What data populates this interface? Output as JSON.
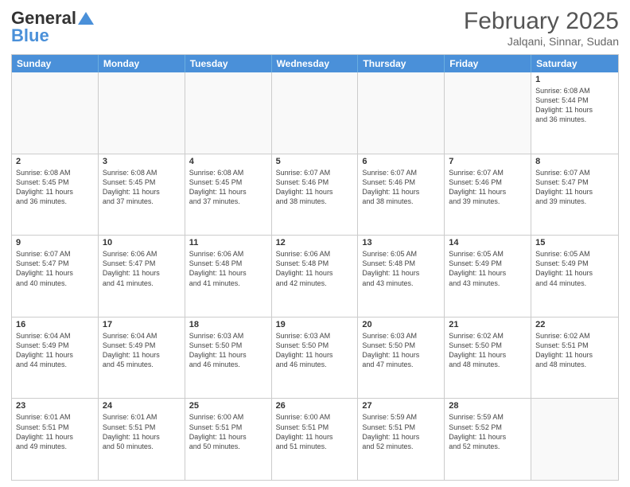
{
  "header": {
    "logo_general": "General",
    "logo_blue": "Blue",
    "month_title": "February 2025",
    "location": "Jalqani, Sinnar, Sudan"
  },
  "day_headers": [
    "Sunday",
    "Monday",
    "Tuesday",
    "Wednesday",
    "Thursday",
    "Friday",
    "Saturday"
  ],
  "weeks": [
    [
      {
        "day": "",
        "info": ""
      },
      {
        "day": "",
        "info": ""
      },
      {
        "day": "",
        "info": ""
      },
      {
        "day": "",
        "info": ""
      },
      {
        "day": "",
        "info": ""
      },
      {
        "day": "",
        "info": ""
      },
      {
        "day": "1",
        "info": "Sunrise: 6:08 AM\nSunset: 5:44 PM\nDaylight: 11 hours\nand 36 minutes."
      }
    ],
    [
      {
        "day": "2",
        "info": "Sunrise: 6:08 AM\nSunset: 5:45 PM\nDaylight: 11 hours\nand 36 minutes."
      },
      {
        "day": "3",
        "info": "Sunrise: 6:08 AM\nSunset: 5:45 PM\nDaylight: 11 hours\nand 37 minutes."
      },
      {
        "day": "4",
        "info": "Sunrise: 6:08 AM\nSunset: 5:45 PM\nDaylight: 11 hours\nand 37 minutes."
      },
      {
        "day": "5",
        "info": "Sunrise: 6:07 AM\nSunset: 5:46 PM\nDaylight: 11 hours\nand 38 minutes."
      },
      {
        "day": "6",
        "info": "Sunrise: 6:07 AM\nSunset: 5:46 PM\nDaylight: 11 hours\nand 38 minutes."
      },
      {
        "day": "7",
        "info": "Sunrise: 6:07 AM\nSunset: 5:46 PM\nDaylight: 11 hours\nand 39 minutes."
      },
      {
        "day": "8",
        "info": "Sunrise: 6:07 AM\nSunset: 5:47 PM\nDaylight: 11 hours\nand 39 minutes."
      }
    ],
    [
      {
        "day": "9",
        "info": "Sunrise: 6:07 AM\nSunset: 5:47 PM\nDaylight: 11 hours\nand 40 minutes."
      },
      {
        "day": "10",
        "info": "Sunrise: 6:06 AM\nSunset: 5:47 PM\nDaylight: 11 hours\nand 41 minutes."
      },
      {
        "day": "11",
        "info": "Sunrise: 6:06 AM\nSunset: 5:48 PM\nDaylight: 11 hours\nand 41 minutes."
      },
      {
        "day": "12",
        "info": "Sunrise: 6:06 AM\nSunset: 5:48 PM\nDaylight: 11 hours\nand 42 minutes."
      },
      {
        "day": "13",
        "info": "Sunrise: 6:05 AM\nSunset: 5:48 PM\nDaylight: 11 hours\nand 43 minutes."
      },
      {
        "day": "14",
        "info": "Sunrise: 6:05 AM\nSunset: 5:49 PM\nDaylight: 11 hours\nand 43 minutes."
      },
      {
        "day": "15",
        "info": "Sunrise: 6:05 AM\nSunset: 5:49 PM\nDaylight: 11 hours\nand 44 minutes."
      }
    ],
    [
      {
        "day": "16",
        "info": "Sunrise: 6:04 AM\nSunset: 5:49 PM\nDaylight: 11 hours\nand 44 minutes."
      },
      {
        "day": "17",
        "info": "Sunrise: 6:04 AM\nSunset: 5:49 PM\nDaylight: 11 hours\nand 45 minutes."
      },
      {
        "day": "18",
        "info": "Sunrise: 6:03 AM\nSunset: 5:50 PM\nDaylight: 11 hours\nand 46 minutes."
      },
      {
        "day": "19",
        "info": "Sunrise: 6:03 AM\nSunset: 5:50 PM\nDaylight: 11 hours\nand 46 minutes."
      },
      {
        "day": "20",
        "info": "Sunrise: 6:03 AM\nSunset: 5:50 PM\nDaylight: 11 hours\nand 47 minutes."
      },
      {
        "day": "21",
        "info": "Sunrise: 6:02 AM\nSunset: 5:50 PM\nDaylight: 11 hours\nand 48 minutes."
      },
      {
        "day": "22",
        "info": "Sunrise: 6:02 AM\nSunset: 5:51 PM\nDaylight: 11 hours\nand 48 minutes."
      }
    ],
    [
      {
        "day": "23",
        "info": "Sunrise: 6:01 AM\nSunset: 5:51 PM\nDaylight: 11 hours\nand 49 minutes."
      },
      {
        "day": "24",
        "info": "Sunrise: 6:01 AM\nSunset: 5:51 PM\nDaylight: 11 hours\nand 50 minutes."
      },
      {
        "day": "25",
        "info": "Sunrise: 6:00 AM\nSunset: 5:51 PM\nDaylight: 11 hours\nand 50 minutes."
      },
      {
        "day": "26",
        "info": "Sunrise: 6:00 AM\nSunset: 5:51 PM\nDaylight: 11 hours\nand 51 minutes."
      },
      {
        "day": "27",
        "info": "Sunrise: 5:59 AM\nSunset: 5:51 PM\nDaylight: 11 hours\nand 52 minutes."
      },
      {
        "day": "28",
        "info": "Sunrise: 5:59 AM\nSunset: 5:52 PM\nDaylight: 11 hours\nand 52 minutes."
      },
      {
        "day": "",
        "info": ""
      }
    ]
  ]
}
